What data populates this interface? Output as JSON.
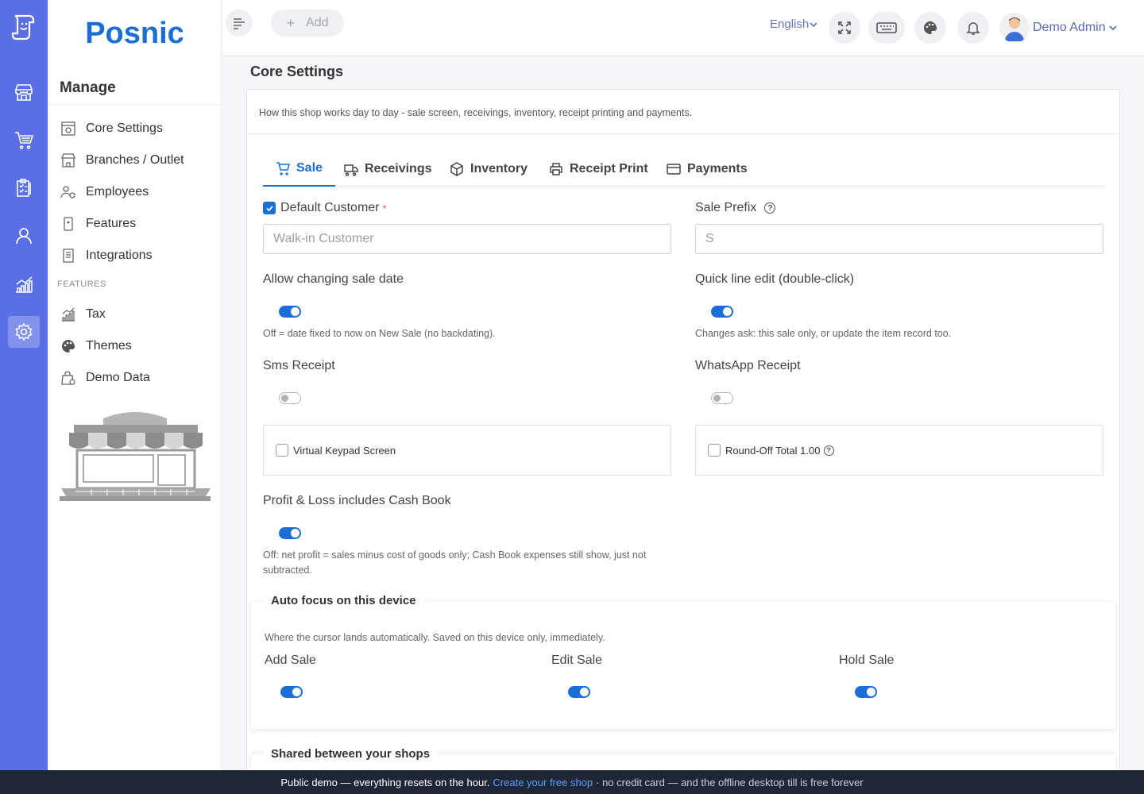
{
  "brand": {
    "name": "Posnic"
  },
  "sidebar": {
    "heading": "Manage",
    "items": [
      {
        "label": "Core Settings",
        "icon": "settings-page-icon"
      },
      {
        "label": "Branches / Outlet",
        "icon": "store-icon"
      },
      {
        "label": "Employees",
        "icon": "employees-icon"
      },
      {
        "label": "Features",
        "icon": "device-icon"
      },
      {
        "label": "Integrations",
        "icon": "receipt-icon"
      }
    ],
    "section_label": "FEATURES",
    "feature_items": [
      {
        "label": "Tax",
        "icon": "chart-icon"
      },
      {
        "label": "Themes",
        "icon": "palette-icon"
      },
      {
        "label": "Demo Data",
        "icon": "bag-icon"
      }
    ]
  },
  "topbar": {
    "add_label": "Add",
    "language": "English",
    "user_name": "Demo Admin"
  },
  "page": {
    "title": "Core Settings",
    "description": "How this shop works day to day - sale screen, receivings, inventory, receipt printing and payments."
  },
  "tabs": [
    {
      "label": "Sale",
      "active": true
    },
    {
      "label": "Receivings",
      "active": false
    },
    {
      "label": "Inventory",
      "active": false
    },
    {
      "label": "Receipt Print",
      "active": false
    },
    {
      "label": "Payments",
      "active": false
    }
  ],
  "form": {
    "default_customer": {
      "label": "Default Customer",
      "required_mark": "*",
      "checked": true,
      "placeholder": "Walk-in Customer"
    },
    "sale_prefix": {
      "label": "Sale Prefix",
      "value": "S"
    },
    "allow_changing_sale_date": {
      "label": "Allow changing sale date",
      "on": true,
      "help": "Off = date fixed to now on New Sale (no backdating)."
    },
    "quick_line_edit": {
      "label": "Quick line edit (double-click)",
      "on": true,
      "help": "Changes ask: this sale only, or update the item record too."
    },
    "sms_receipt": {
      "label": "Sms Receipt",
      "on": false
    },
    "whatsapp_receipt": {
      "label": "WhatsApp Receipt",
      "on": false
    },
    "virtual_keypad": {
      "label": "Virtual Keypad Screen",
      "checked": false
    },
    "round_off": {
      "label": "Round-Off Total 1.00",
      "checked": false
    },
    "profit_loss_cashbook": {
      "label": "Profit & Loss includes Cash Book",
      "on": true,
      "help": "Off: net profit = sales minus cost of goods only; Cash Book expenses still show, just not subtracted."
    }
  },
  "auto_focus": {
    "title": "Auto focus on this device",
    "description": "Where the cursor lands automatically. Saved on this device only, immediately.",
    "items": [
      {
        "label": "Add Sale",
        "on": true
      },
      {
        "label": "Edit Sale",
        "on": true
      },
      {
        "label": "Hold Sale",
        "on": true
      }
    ]
  },
  "shared": {
    "title": "Shared between your shops"
  },
  "footer": {
    "lead": "Public demo — everything resets on the hour.",
    "link": "Create your free shop",
    "tail": "· no credit card — and the offline desktop till is free forever"
  },
  "colors": {
    "rail": "#5a6ee6",
    "accent": "#1b6ed6",
    "footer_bg": "#1f2636"
  }
}
